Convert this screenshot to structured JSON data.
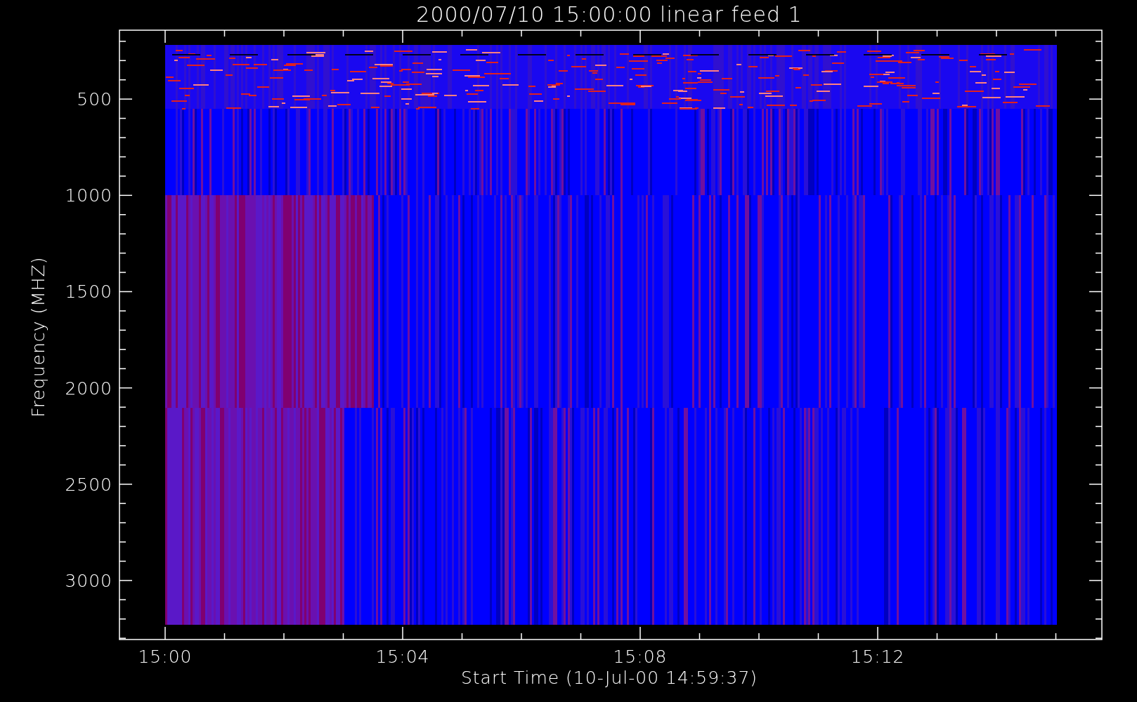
{
  "plot": {
    "title": "2000/07/10 15:00:00 linear feed 1",
    "y_axis": {
      "label": "Frequency (MHZ)",
      "tick_labels": [
        "500",
        "1000",
        "1500",
        "2000",
        "2500",
        "3000"
      ]
    },
    "x_axis": {
      "label": "Start Time (10-Jul-00 14:59:37)",
      "tick_labels": [
        "15:00",
        "15:04",
        "15:08",
        "15:12"
      ]
    }
  }
}
